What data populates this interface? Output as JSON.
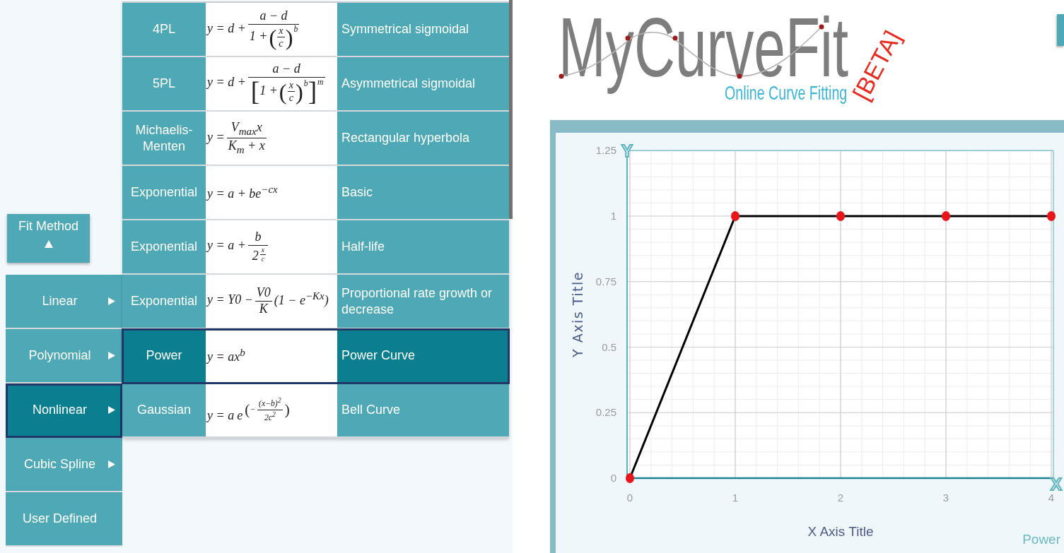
{
  "sidebar": {
    "fit_method_button": {
      "label": "Fit Method",
      "expanded": true
    },
    "menu": [
      {
        "label": "Linear",
        "has_submenu": true,
        "selected": false
      },
      {
        "label": "Polynomial",
        "has_submenu": true,
        "selected": false
      },
      {
        "label": "Nonlinear",
        "has_submenu": true,
        "selected": true
      },
      {
        "label": "Cubic Spline",
        "has_submenu": true,
        "selected": false
      },
      {
        "label": "User Defined",
        "has_submenu": false,
        "selected": false
      }
    ]
  },
  "method_table": {
    "rows": [
      {
        "column_1": "4PL",
        "column_2": [
          {
            "kind": "text",
            "text": "y = d +"
          },
          {
            "kind": "frac",
            "num": [
              {
                "kind": "text",
                "text": "a − d"
              }
            ],
            "den": [
              {
                "kind": "text",
                "text": "1 +"
              },
              {
                "kind": "group",
                "open": "(",
                "close": ")",
                "body": [
                  {
                    "kind": "frac",
                    "num": [
                      {
                        "kind": "text",
                        "text": "x"
                      }
                    ],
                    "den": [
                      {
                        "kind": "text",
                        "text": "c"
                      }
                    ]
                  }
                ],
                "sup": [
                  {
                    "kind": "text",
                    "text": "b"
                  }
                ]
              }
            ]
          }
        ],
        "column_3": "Symmetrical sigmoidal",
        "selected": false
      },
      {
        "column_1": "5PL",
        "column_2": [
          {
            "kind": "text",
            "text": "y = d +"
          },
          {
            "kind": "frac",
            "num": [
              {
                "kind": "text",
                "text": "a − d"
              }
            ],
            "den": [
              {
                "kind": "group",
                "open": "[",
                "close": "]",
                "body": [
                  {
                    "kind": "text",
                    "text": "1 +"
                  },
                  {
                    "kind": "group",
                    "open": "(",
                    "close": ")",
                    "body": [
                      {
                        "kind": "frac",
                        "num": [
                          {
                            "kind": "text",
                            "text": "x"
                          }
                        ],
                        "den": [
                          {
                            "kind": "text",
                            "text": "c"
                          }
                        ]
                      }
                    ],
                    "sup": [
                      {
                        "kind": "text",
                        "text": "b"
                      }
                    ]
                  }
                ],
                "sup": [
                  {
                    "kind": "text",
                    "text": "m"
                  }
                ]
              }
            ]
          }
        ],
        "column_3": "Asymmetrical sigmoidal",
        "selected": false
      },
      {
        "column_1": "Michaelis-Menten",
        "column_2": [
          {
            "kind": "text",
            "text": "y ="
          },
          {
            "kind": "frac",
            "num": [
              {
                "kind": "text",
                "text": "V$_{max}$x"
              }
            ],
            "den": [
              {
                "kind": "text",
                "text": "K$_{m}$ + x"
              }
            ]
          }
        ],
        "column_3": "Rectangular hyperbola",
        "selected": false
      },
      {
        "column_1": "Exponential",
        "column_2": [
          {
            "kind": "text",
            "text": "y = a + be$^{−cx}$"
          }
        ],
        "column_3": "Basic",
        "selected": false
      },
      {
        "column_1": "Exponential",
        "column_2": [
          {
            "kind": "text",
            "text": "y = a +"
          },
          {
            "kind": "frac",
            "num": [
              {
                "kind": "text",
                "text": "b"
              }
            ],
            "den": [
              {
                "kind": "group",
                "body": [
                  {
                    "kind": "text",
                    "text": "2"
                  }
                ],
                "sup": [
                  {
                    "kind": "frac",
                    "num": [
                      {
                        "kind": "text",
                        "text": "x"
                      }
                    ],
                    "den": [
                      {
                        "kind": "text",
                        "text": "c"
                      }
                    ]
                  }
                ]
              }
            ]
          }
        ],
        "column_3": "Half-life",
        "selected": false
      },
      {
        "column_1": "Exponential",
        "column_2": [
          {
            "kind": "text",
            "text": "y = Y0 −"
          },
          {
            "kind": "frac",
            "num": [
              {
                "kind": "text",
                "text": "V0"
              }
            ],
            "den": [
              {
                "kind": "text",
                "text": "K"
              }
            ]
          },
          {
            "kind": "text",
            "text": "(1 − e$^{−Kx}$)"
          }
        ],
        "column_3": "Proportional rate growth or decrease",
        "selected": false
      },
      {
        "column_1": "Power",
        "column_2": [
          {
            "kind": "text",
            "text": "y = ax$^{b}$"
          }
        ],
        "column_3": "Power Curve",
        "selected": true
      },
      {
        "column_1": "Gaussian",
        "column_2": [
          {
            "kind": "text",
            "text": "y = a"
          },
          {
            "kind": "group",
            "body": [
              {
                "kind": "text",
                "text": "e"
              }
            ],
            "sup": [
              {
                "kind": "group",
                "open": "(",
                "close": ")",
                "body": [
                  {
                    "kind": "text",
                    "text": "−"
                  },
                  {
                    "kind": "frac",
                    "num": [
                      {
                        "kind": "text",
                        "text": "(x−b)$^{2}$"
                      }
                    ],
                    "den": [
                      {
                        "kind": "text",
                        "text": "2c$^{2}$"
                      }
                    ]
                  }
                ]
              }
            ]
          }
        ],
        "column_3": "Bell Curve",
        "selected": false
      }
    ]
  },
  "header": {
    "logo": {
      "wordmark": "MyCurveFit",
      "tagline": "Online Curve Fitting",
      "badge": "[BETA]"
    }
  },
  "chart": {
    "y_handle": "Y",
    "x_handle": "X",
    "chart_data": {
      "type": "line",
      "xlabel": "X Axis Title",
      "ylabel": "Y Axis Title",
      "x": [
        0,
        1,
        2,
        3,
        4
      ],
      "xlim": [
        0,
        4
      ],
      "ylim": [
        0,
        1.25
      ],
      "xticks": [
        0,
        1,
        2,
        3,
        4
      ],
      "yticks": [
        0,
        0.25,
        0.5,
        0.75,
        1,
        1.25
      ],
      "grid": true,
      "series": [
        {
          "name": "Power",
          "color": "#000000",
          "values": [
            0,
            1,
            1,
            1,
            1
          ],
          "marker": "circle"
        }
      ]
    }
  }
}
